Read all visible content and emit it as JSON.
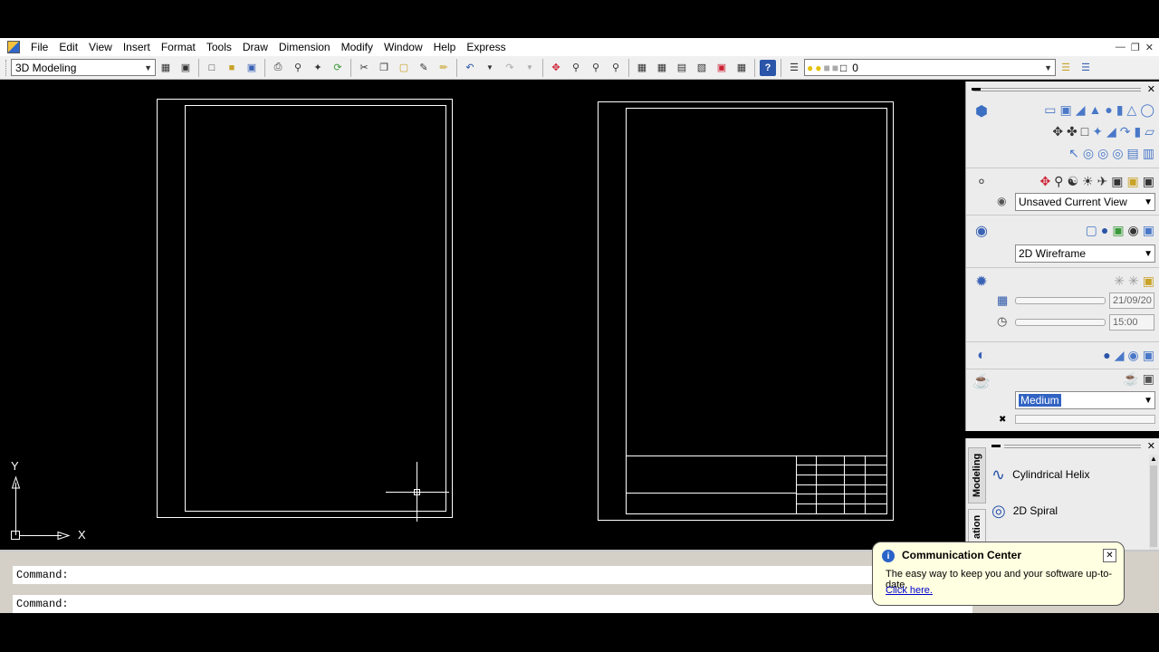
{
  "menu": {
    "items": [
      "File",
      "Edit",
      "View",
      "Insert",
      "Format",
      "Tools",
      "Draw",
      "Dimension",
      "Modify",
      "Window",
      "Help",
      "Express"
    ]
  },
  "toolbar": {
    "workspace": "3D Modeling",
    "layer": "0"
  },
  "palette": {
    "view_select": "Unsaved Current View",
    "visual_style": "2D Wireframe",
    "date_value": "21/09/20",
    "time_value": "15:00",
    "render_preset": "Medium"
  },
  "tool_palette": {
    "tab_modeling": "Modeling",
    "tab_annotation": "ation",
    "items": [
      "Cylindrical Helix",
      "2D Spiral"
    ]
  },
  "command": {
    "line1": "Command:",
    "line2": "Command:"
  },
  "ucs": {
    "x_label": "X",
    "y_label": "Y"
  },
  "balloon": {
    "title": "Communication Center",
    "text": "The easy way to keep you and your software up-to-date.",
    "link": "Click here."
  }
}
